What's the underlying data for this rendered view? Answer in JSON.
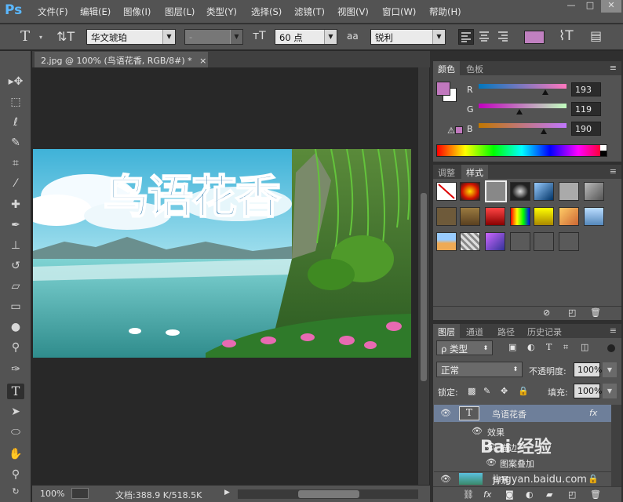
{
  "app": {
    "logo": "Ps"
  },
  "menu": [
    "文件(F)",
    "编辑(E)",
    "图像(I)",
    "图层(L)",
    "类型(Y)",
    "选择(S)",
    "滤镜(T)",
    "视图(V)",
    "窗口(W)",
    "帮助(H)"
  ],
  "window": {
    "minimize": "—",
    "restore": "□",
    "close": "✕"
  },
  "options": {
    "tool_glyph": "T",
    "font_family": "华文琥珀",
    "font_style": "-",
    "font_size": "60 点",
    "aa_label": "aa",
    "antialias": "锐利",
    "text_color": "#c080c0"
  },
  "document": {
    "tab_title": "2.jpg @ 100% (鸟语花香, RGB/8#) *",
    "close": "×",
    "canvas_text": "鸟语花香"
  },
  "status": {
    "zoom": "100%",
    "doc_info": "文档:388.9 K/518.5K"
  },
  "color_panel": {
    "tabs": [
      "颜色",
      "色板"
    ],
    "r_label": "R",
    "g_label": "G",
    "b_label": "B",
    "r": "193",
    "g": "119",
    "b": "190",
    "fg": "#c178be",
    "bg": "#ffffff",
    "r_fill": 0.757,
    "g_fill": 0.467,
    "b_fill": 0.745
  },
  "styles_panel": {
    "tabs": [
      "调整",
      "样式"
    ]
  },
  "layers_panel": {
    "tabs": [
      "图层",
      "通道",
      "路径",
      "历史记录"
    ],
    "filter_kind": "ρ 类型",
    "blend_mode": "正常",
    "opacity_label": "不透明度:",
    "opacity": "100%",
    "lock_label": "锁定:",
    "fill_label": "填充:",
    "fill": "100%",
    "layers": [
      {
        "name": "鸟语花香",
        "type_glyph": "T",
        "fx": "fx"
      },
      {
        "name": "效果"
      },
      {
        "name": "描边"
      },
      {
        "name": "图案叠加"
      },
      {
        "name": "背景"
      }
    ]
  },
  "watermark": {
    "text": "Bai 经验",
    "url": "jingyan.baidu.com"
  },
  "colors": {
    "bg_dark": "#282828",
    "panel": "#535353",
    "accent": "#5bb8ff"
  }
}
